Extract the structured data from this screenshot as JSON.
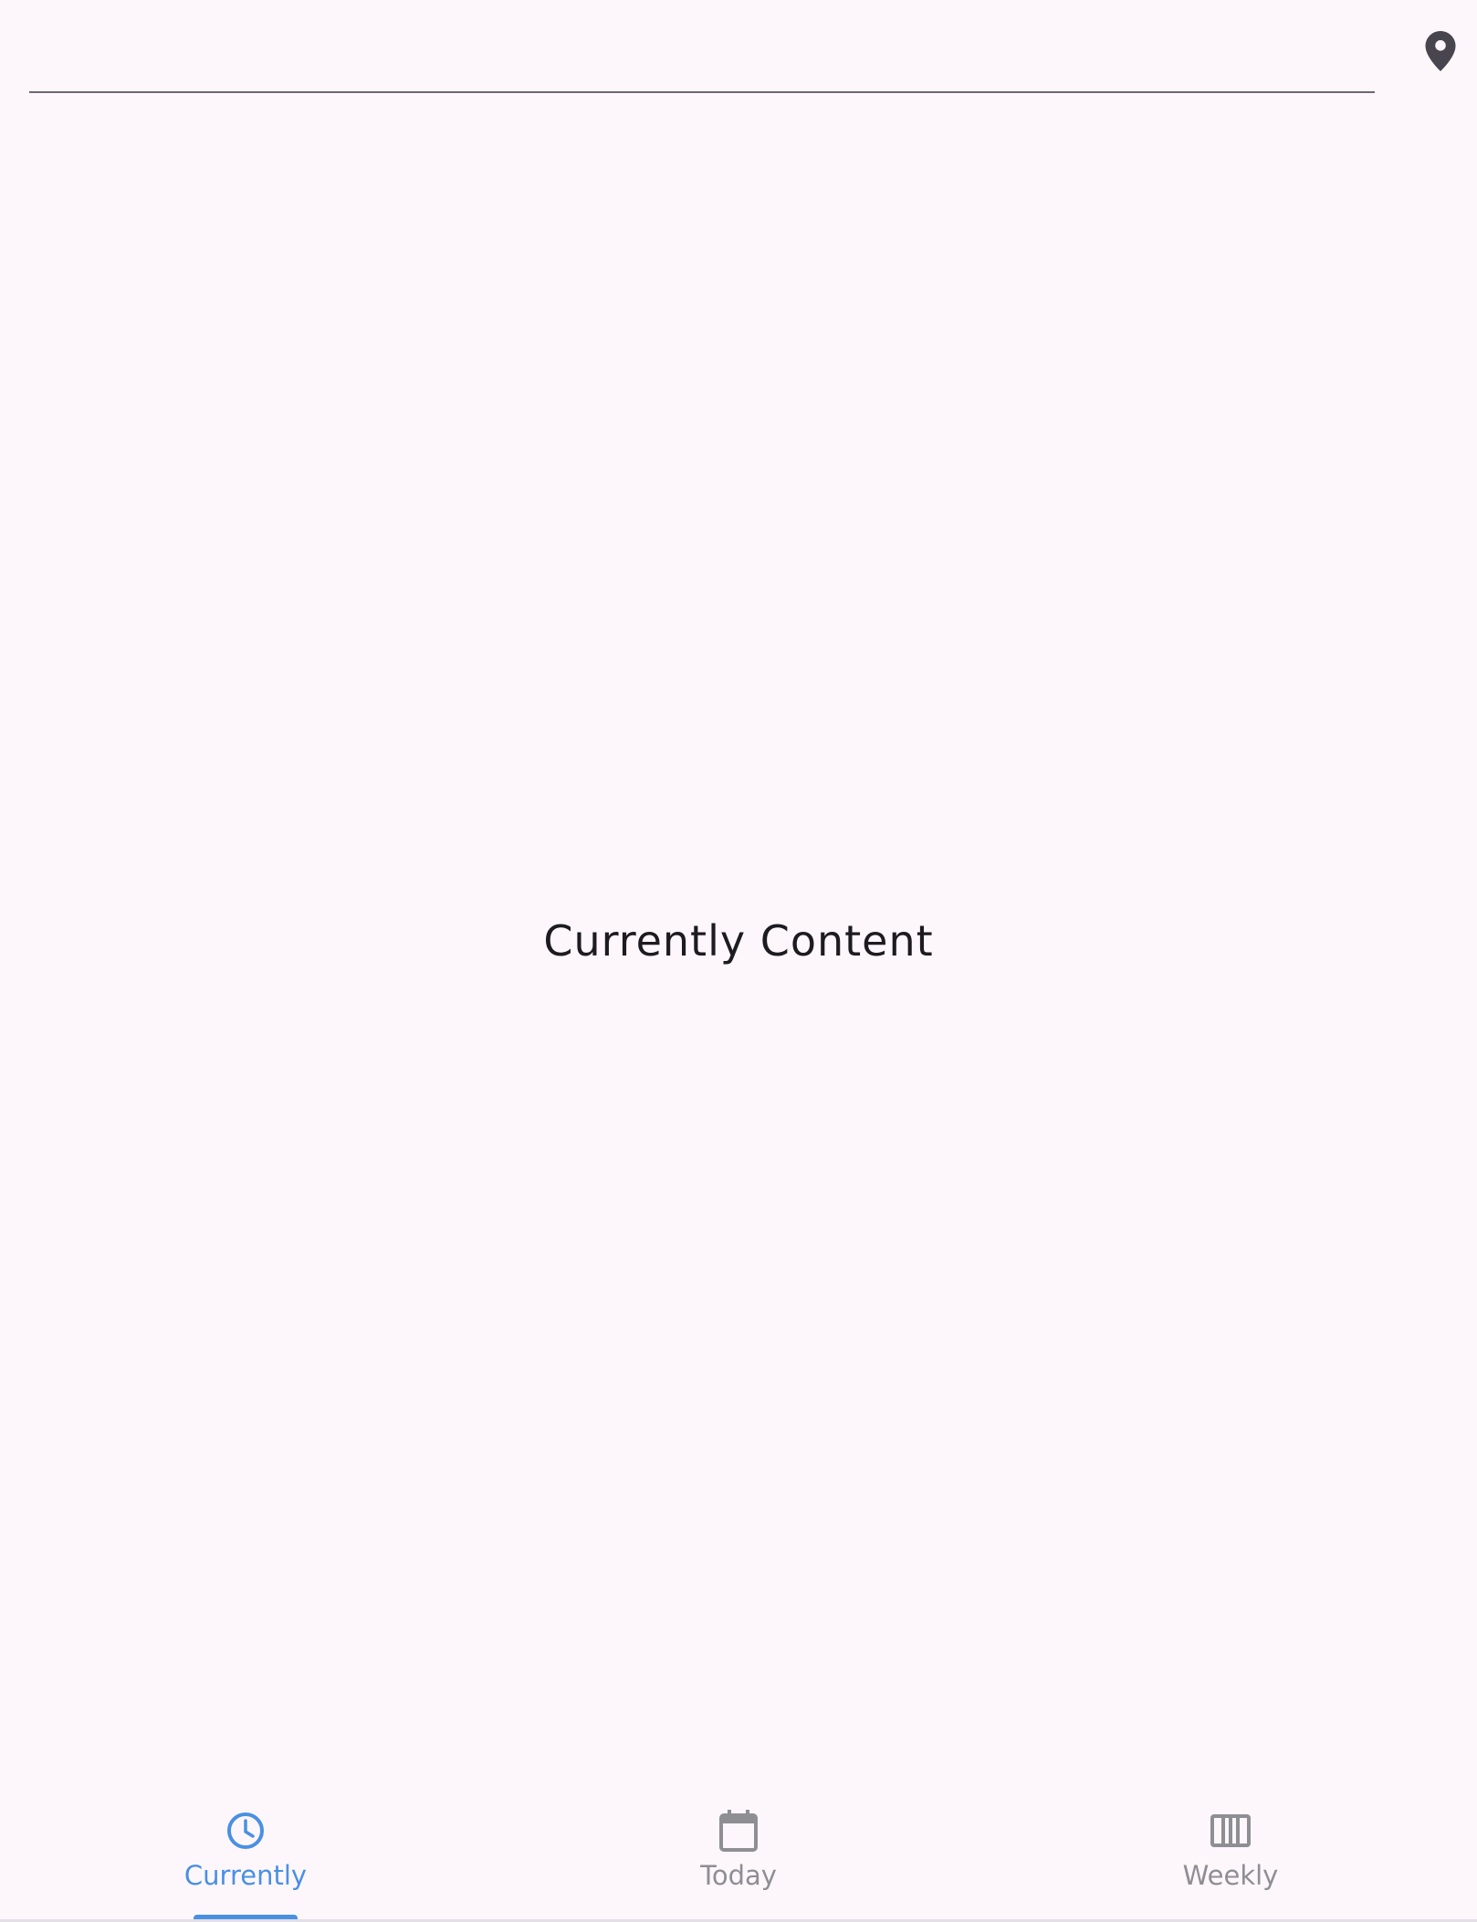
{
  "search": {
    "value": "",
    "placeholder": ""
  },
  "location_button": {
    "icon": "location-pin-icon"
  },
  "main": {
    "content_text": "Currently Content"
  },
  "tabs": [
    {
      "label": "Currently",
      "icon": "clock-icon",
      "selected": true
    },
    {
      "label": "Today",
      "icon": "calendar-icon",
      "selected": false
    },
    {
      "label": "Weekly",
      "icon": "view-week-icon",
      "selected": false
    }
  ],
  "colors": {
    "accent": "#4a90e2",
    "inactive": "#8e8e93",
    "background": "#fdf7fc",
    "text": "#1d1b20"
  }
}
